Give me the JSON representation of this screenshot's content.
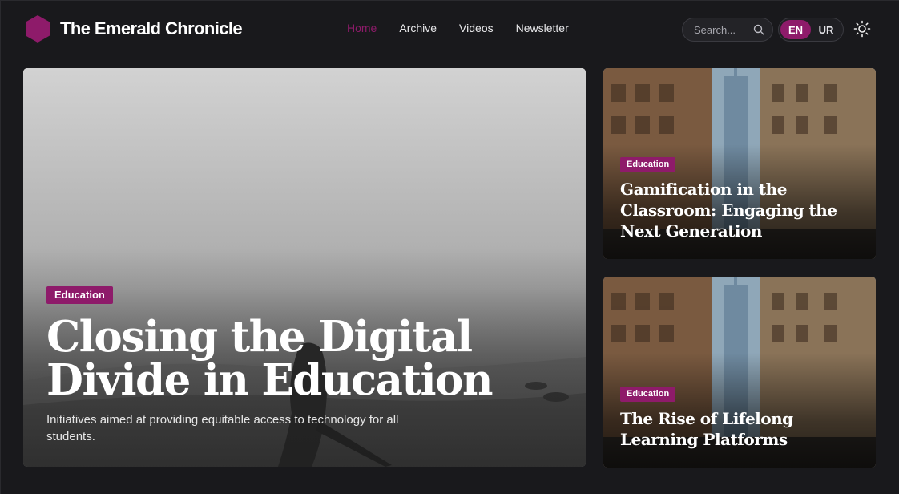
{
  "brand": {
    "name": "The Emerald Chronicle"
  },
  "nav": {
    "items": [
      {
        "label": "Home",
        "active": true
      },
      {
        "label": "Archive",
        "active": false
      },
      {
        "label": "Videos",
        "active": false
      },
      {
        "label": "Newsletter",
        "active": false
      }
    ]
  },
  "search": {
    "placeholder": "Search..."
  },
  "lang": {
    "options": [
      "EN",
      "UR"
    ],
    "selected": "EN"
  },
  "featured": {
    "category": "Education",
    "title": "Closing the Digital Divide in Education",
    "description": "Initiatives aimed at providing equitable access to technology for all students."
  },
  "side_articles": [
    {
      "category": "Education",
      "title": "Gamification in the Classroom: Engaging the Next Generation"
    },
    {
      "category": "Education",
      "title": "The Rise of Lifelong Learning Platforms"
    }
  ],
  "colors": {
    "accent": "#8e1b6a",
    "background": "#19191c",
    "text": "#ffffff"
  },
  "icons": {
    "logo": "hexagon-logo-icon",
    "search": "search-icon",
    "theme": "sun-icon"
  }
}
